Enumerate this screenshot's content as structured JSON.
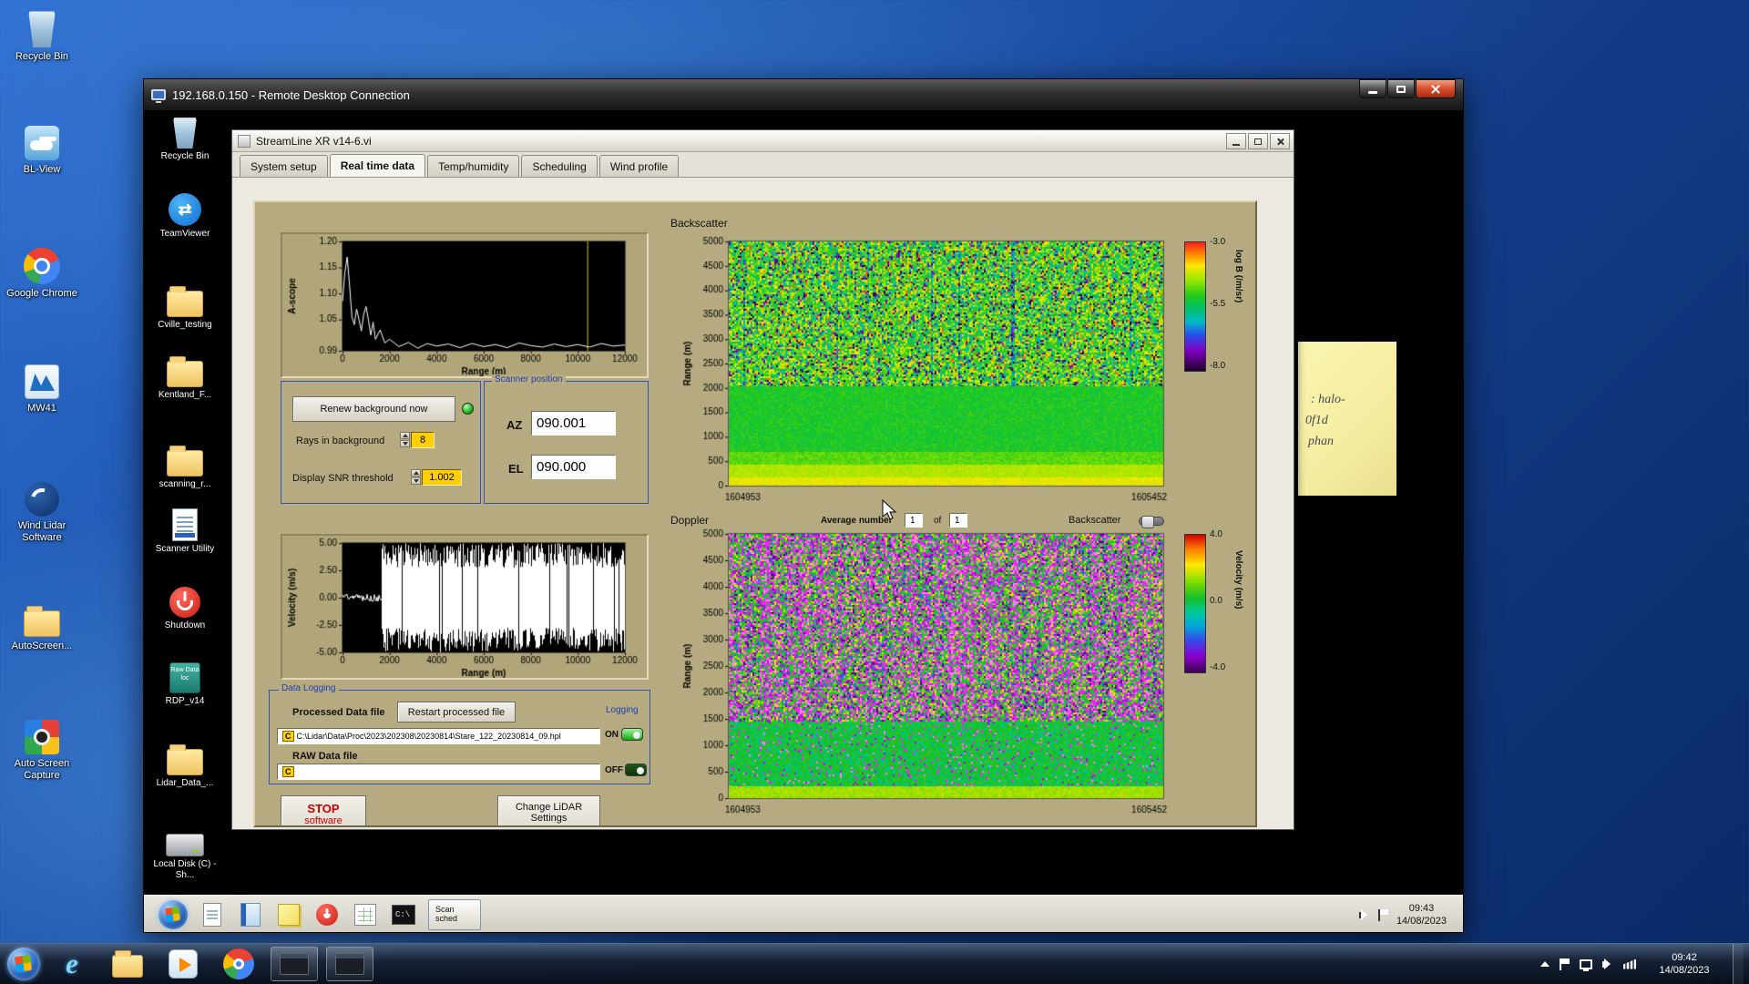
{
  "host": {
    "desktop_icons": [
      {
        "label": "Recycle Bin",
        "icon": "recycle-bin-icon"
      },
      {
        "label": "BL-View",
        "icon": "bl-view-icon"
      },
      {
        "label": "Google Chrome",
        "icon": "chrome-icon"
      },
      {
        "label": "MW41",
        "icon": "mw41-icon"
      },
      {
        "label": "Wind Lidar Software",
        "icon": "wind-lidar-icon"
      },
      {
        "label": "AutoScreen...",
        "icon": "folder-icon"
      },
      {
        "label": "Auto Screen Capture",
        "icon": "screen-capture-icon"
      }
    ],
    "taskbar": {
      "clock_time": "09:42",
      "clock_date": "14/08/2023"
    }
  },
  "rdp": {
    "title": "192.168.0.150 - Remote Desktop Connection",
    "desktop_icons": [
      {
        "label": "Recycle Bin",
        "icon": "recycle-bin-icon"
      },
      {
        "label": "TeamViewer",
        "icon": "teamviewer-icon",
        "glyph": "⇄"
      },
      {
        "label": "Cville_testing",
        "icon": "folder-icon"
      },
      {
        "label": "Kentland_F...",
        "icon": "folder-icon"
      },
      {
        "label": "scanning_r...",
        "icon": "folder-icon"
      },
      {
        "label": "Scanner Utility",
        "icon": "scanner-utility-icon"
      },
      {
        "label": "Shutdown",
        "icon": "power-icon"
      },
      {
        "label": "RDP_v14",
        "icon": "raw-data-icon",
        "icon_text": "Raw Data loc"
      },
      {
        "label": "Lidar_Data_...",
        "icon": "folder-icon"
      },
      {
        "label": "Local Disk (C) - Sh...",
        "icon": "drive-icon"
      }
    ],
    "sticky_note": {
      "lines": [
        ": halo-",
        "0f1d",
        "phan"
      ]
    },
    "taskbar": {
      "clock_time": "09:43",
      "clock_date": "14/08/2023",
      "window_button": "Scan sched",
      "cmd_text": "C:\\"
    }
  },
  "app": {
    "title": "StreamLine XR v14-6.vi",
    "tabs": [
      "System setup",
      "Real time data",
      "Temp/humidity",
      "Scheduling",
      "Wind profile"
    ],
    "sections": {
      "backscatter": "Backscatter",
      "doppler": "Doppler"
    },
    "controls": {
      "renew_button": "Renew background now",
      "rays_label": "Rays in background",
      "rays_value": "8",
      "snr_label": "Display SNR threshold",
      "snr_value": "1.002",
      "scanner_box_label": "Scanner position",
      "az_label": "AZ",
      "az_value": "090.001",
      "el_label": "EL",
      "el_value": "090.000",
      "average_label": "Average number",
      "average_value": "1",
      "of_label": "of",
      "of_value": "1",
      "backscatter_toggle_label": "Backscatter"
    },
    "logging": {
      "box_label": "Data Logging",
      "processed_label": "Processed Data file",
      "restart_button": "Restart processed file",
      "logging_label": "Logging",
      "drive_badge": "C",
      "processed_path": "C:\\Lidar\\Data\\Proc\\2023\\202308\\20230814\\Stare_122_20230814_09.hpl",
      "on_label": "ON",
      "raw_label": "RAW Data file",
      "raw_path": "",
      "off_label": "OFF"
    },
    "footer_buttons": {
      "stop_line1": "STOP",
      "stop_line2": "software",
      "change_line1": "Change LiDAR",
      "change_line2": "Settings"
    }
  },
  "chart_data": [
    {
      "id": "a_scope",
      "type": "line",
      "ylabel": "A-scope",
      "xlabel": "Range (m)",
      "xlim": [
        0,
        12000
      ],
      "ylim": [
        0.99,
        1.2
      ],
      "xticks": [
        0,
        2000,
        4000,
        6000,
        8000,
        10000,
        12000
      ],
      "yticks": [
        "1.20",
        "1.15",
        "1.10",
        "1.05",
        "0.99"
      ],
      "cursor_x": 10400,
      "x": [
        0,
        100,
        200,
        300,
        400,
        500,
        600,
        700,
        800,
        900,
        1000,
        1100,
        1200,
        1300,
        1400,
        1600,
        1800,
        2000,
        2400,
        2800,
        3200,
        3600,
        4000,
        4500,
        5000,
        5500,
        6000,
        6500,
        7000,
        7500,
        8000,
        8500,
        9000,
        9500,
        10000,
        10500,
        11000,
        11500,
        12000
      ],
      "y": [
        1.085,
        1.14,
        1.17,
        1.115,
        1.055,
        1.04,
        1.07,
        1.05,
        1.028,
        1.06,
        1.075,
        1.05,
        1.02,
        1.045,
        1.012,
        1.03,
        1.005,
        1.012,
        0.998,
        1.006,
        0.995,
        1.004,
        0.999,
        1.003,
        0.996,
        1.004,
        0.998,
        1.002,
        0.996,
        1.005,
        1.0,
        0.997,
        1.003,
        0.998,
        1.002,
        0.997,
        1.004,
        0.999,
        1.001
      ]
    },
    {
      "id": "velocity",
      "type": "line_noise",
      "ylabel": "Velocity (m/s)",
      "xlabel": "Range (m)",
      "xlim": [
        0,
        12000
      ],
      "ylim": [
        -5,
        5
      ],
      "xticks": [
        0,
        2000,
        4000,
        6000,
        8000,
        10000,
        12000
      ],
      "yticks": [
        "5.00",
        "2.50",
        "0.00",
        "-2.50",
        "-5.00"
      ],
      "noise_start_x": 1700,
      "seed": 7,
      "description": "near-zero trace below ~1700 m; saturated +/-5 m/s noise comb from ~1700 m to 12000 m"
    },
    {
      "id": "backscatter",
      "type": "heatmap",
      "title": "Backscatter",
      "ylabel": "Range (m)",
      "ylim": [
        0,
        5000
      ],
      "yticks": [
        5000,
        4500,
        4000,
        3500,
        3000,
        2500,
        2000,
        1500,
        1000,
        500,
        0
      ],
      "x_start_label": "1604953",
      "x_end_label": "1605452",
      "seed": 13,
      "colorbar": {
        "label": "log B (/m/sr)",
        "ticks": [
          "-3.0",
          "-5.5",
          "-8.0"
        ],
        "range": [
          -3.0,
          -8.0
        ]
      },
      "structure": "bright aerosol backscatter band below ~700 m, smooth green 700-2000 m, yellow/green/dark speckle noise above 2000 m"
    },
    {
      "id": "doppler",
      "type": "heatmap",
      "title": "Doppler",
      "ylabel": "Range (m)",
      "ylim": [
        0,
        5000
      ],
      "yticks": [
        5000,
        4500,
        4000,
        3500,
        3000,
        2500,
        2000,
        1500,
        1000,
        500,
        0
      ],
      "x_start_label": "1604953",
      "x_end_label": "1605452",
      "seed": 29,
      "colorbar": {
        "label": "Velocity (m/s)",
        "ticks": [
          "4.0",
          "0.0",
          "-4.0"
        ],
        "range": [
          4.0,
          -4.0
        ]
      },
      "structure": "coherent near-zero (green) velocities below ~1400 m, magenta/pink folding noise with vertical streaks above"
    }
  ]
}
